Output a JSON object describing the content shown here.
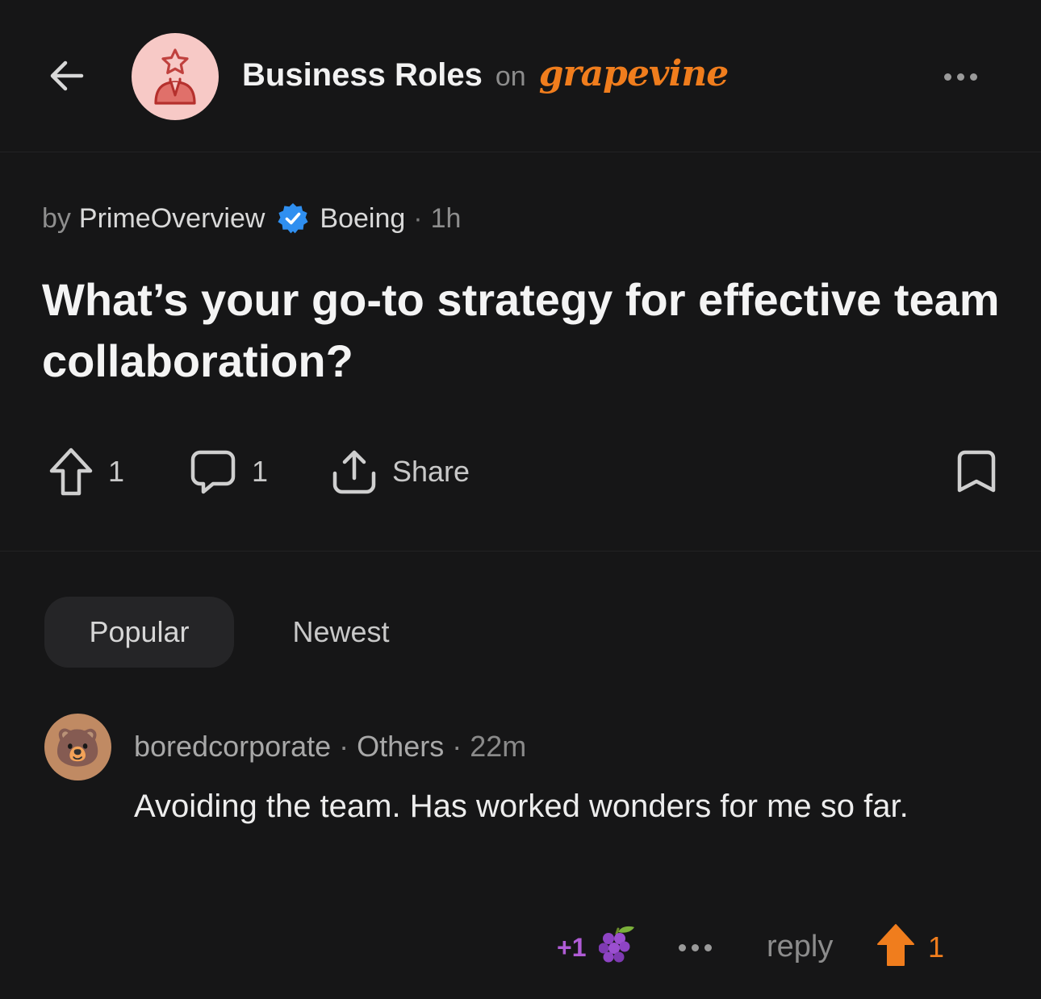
{
  "header": {
    "community_name": "Business Roles",
    "on_text": "on",
    "brand": "grapevine",
    "icons": {
      "back": "arrow-left-icon",
      "community": "business-person-star-icon",
      "more": "more-horizontal-icon"
    }
  },
  "post": {
    "by_label": "by",
    "author": "PrimeOverview",
    "company": "Boeing",
    "separator": "·",
    "time": "1h",
    "title": "What’s your go-to strategy for effective team collaboration?",
    "upvotes": "1",
    "comments": "1",
    "share_label": "Share"
  },
  "tabs": {
    "popular": "Popular",
    "newest": "Newest",
    "selected": "Popular"
  },
  "comment": {
    "avatar_emoji": "🐻",
    "username": "boredcorporate",
    "separator": "·",
    "group": "Others",
    "time": "22m",
    "body": "Avoiding the team. Has worked wonders for me so far.",
    "grape_count": "+1",
    "grape_emoji": "🍇",
    "reply_label": "reply",
    "upvotes": "1"
  },
  "colors": {
    "background": "#161617",
    "accent_orange": "#f07d1d",
    "grape_purple": "#b05cd6",
    "verified_blue": "#2f8ff0",
    "community_avatar_bg": "#f7c9c6",
    "tab_selected_bg": "#252527"
  }
}
